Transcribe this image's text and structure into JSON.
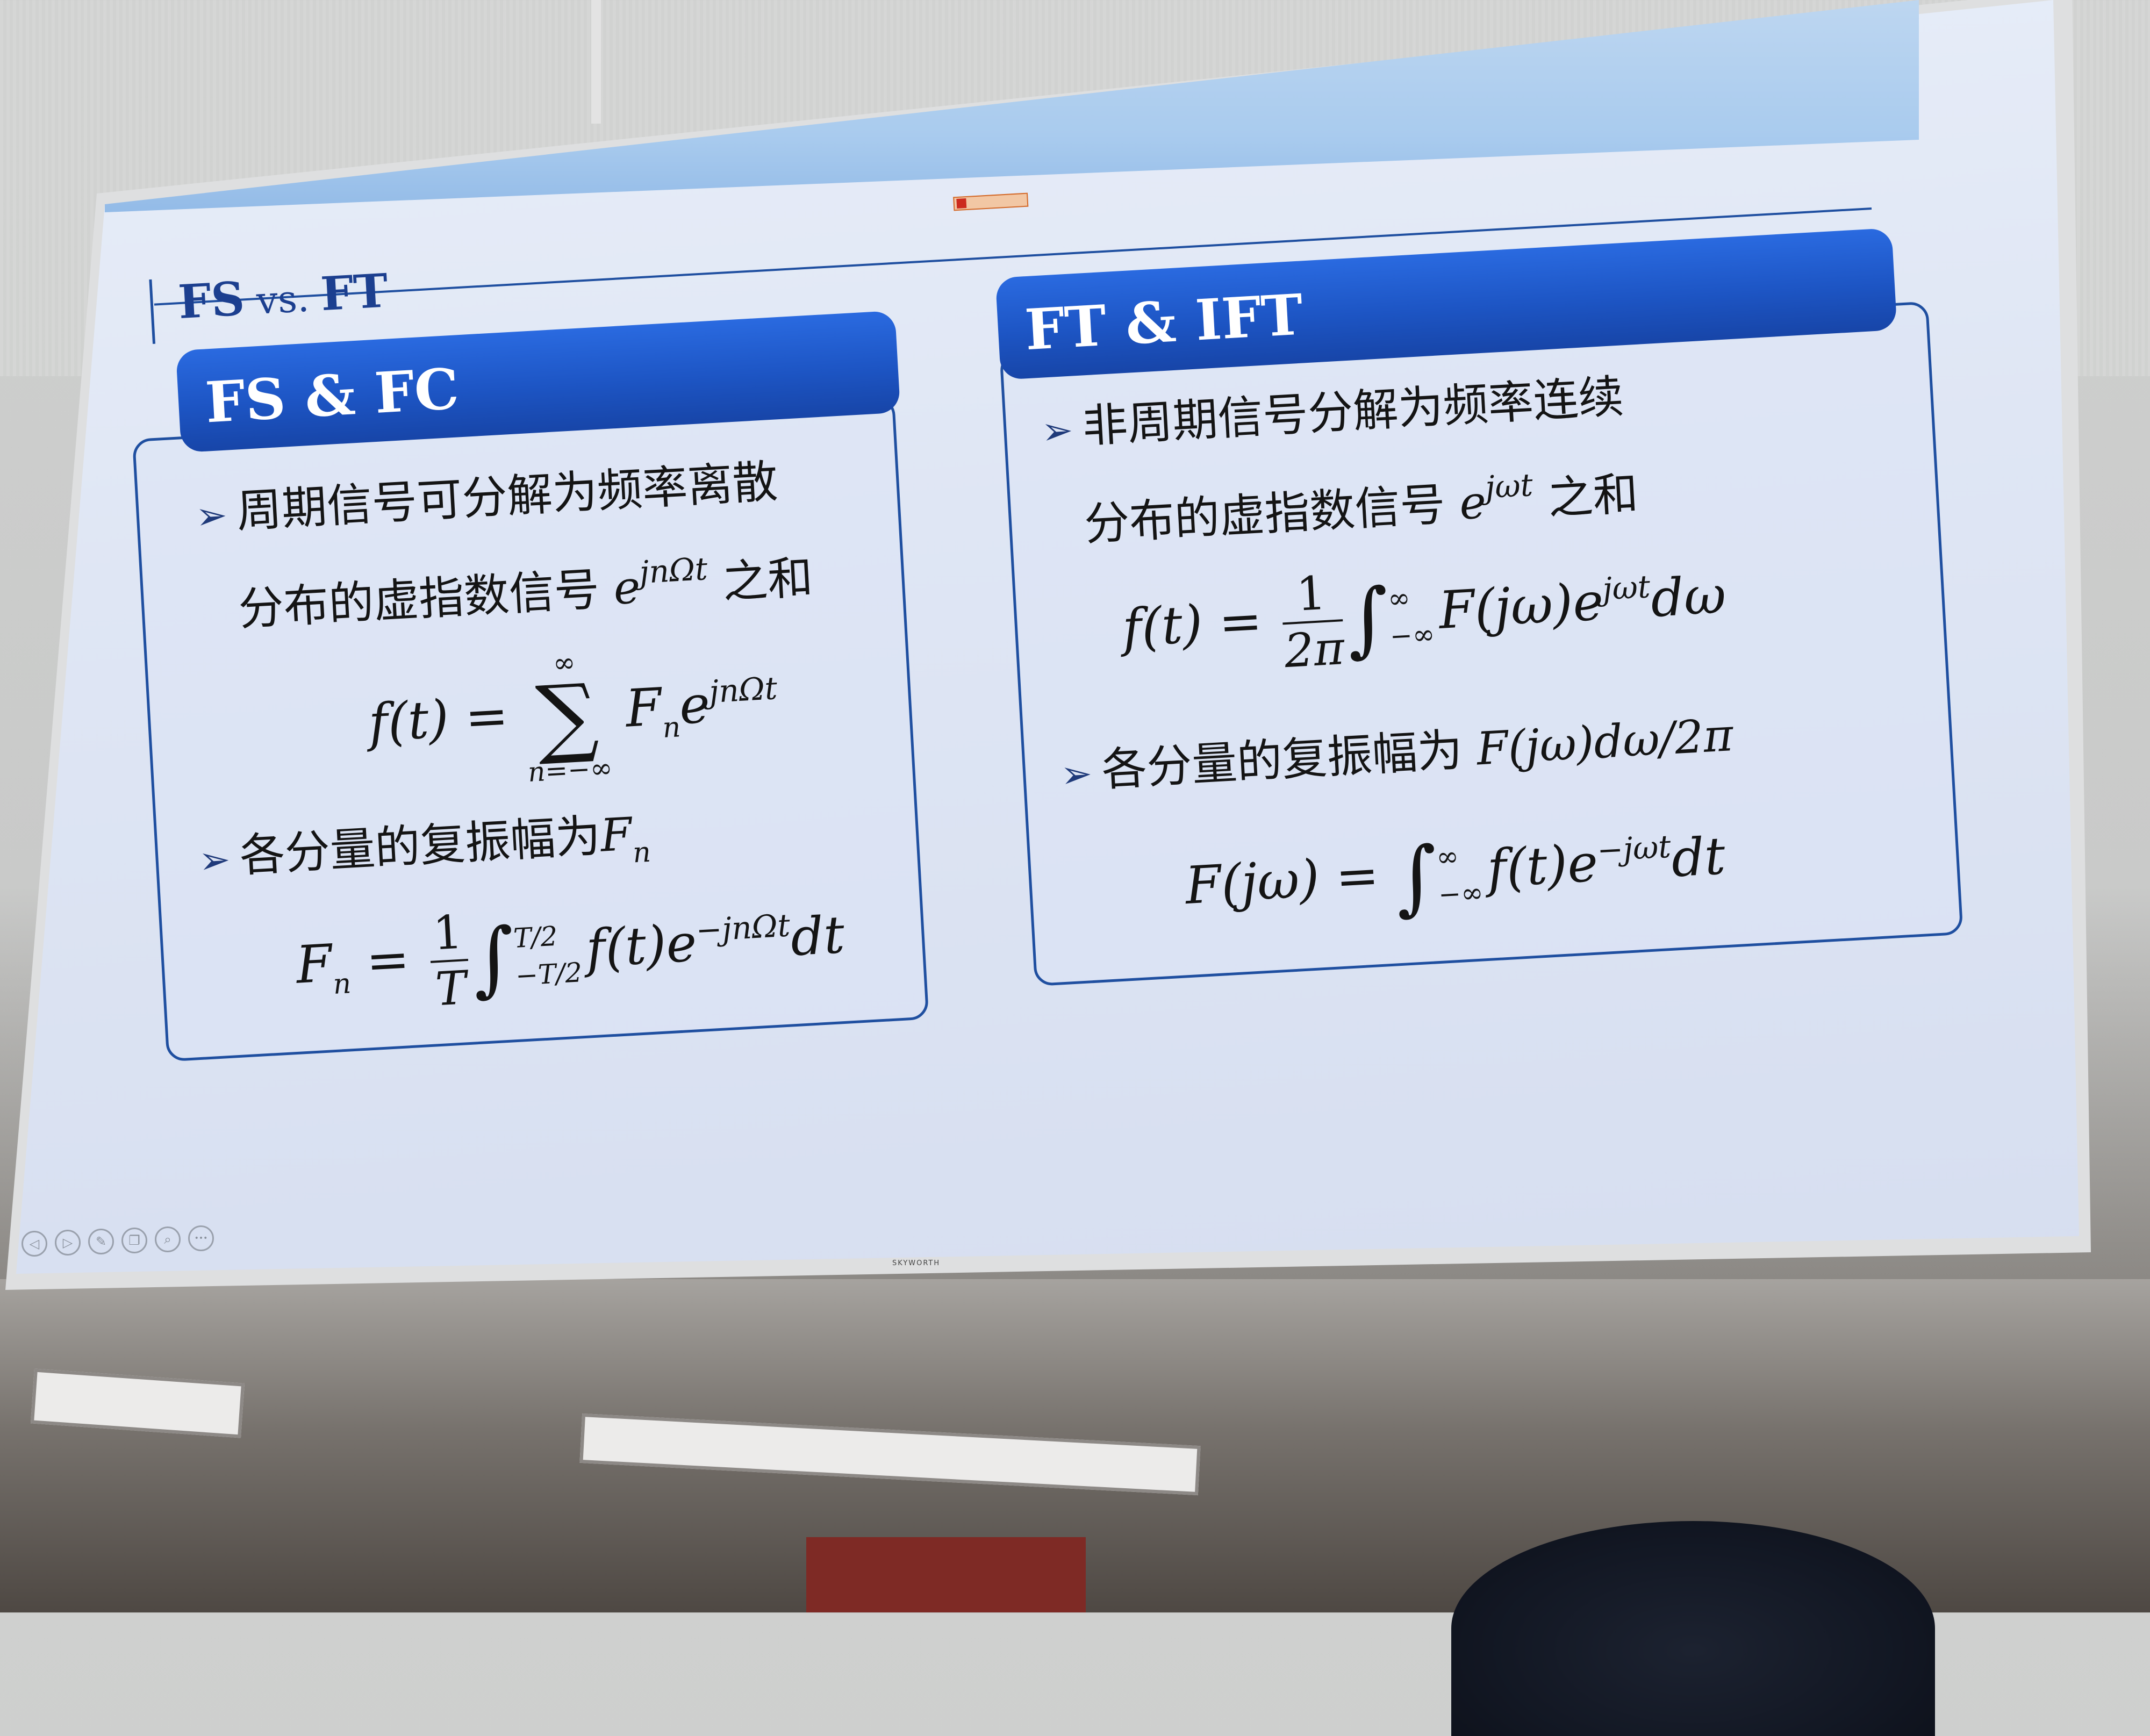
{
  "slide": {
    "logo_text": "",
    "title_main": "FS",
    "title_vs": " vs. ",
    "title_end": "FT",
    "left": {
      "heading": "FS & FC",
      "bullet1_line1": "周期信号可分解为频率离散",
      "bullet1_line2": "分布的虚指数信号",
      "bullet1_exp_base": "e",
      "bullet1_exp_sup": "jnΩt",
      "bullet1_tail": "之和",
      "formula1_lhs": "f(t) =",
      "formula1_sigma_top": "∞",
      "formula1_sigma": "∑",
      "formula1_sigma_bottom": "n=−∞",
      "formula1_term": "F",
      "formula1_term_sub": "n",
      "formula1_exp_base": "e",
      "formula1_exp_sup": "jnΩt",
      "bullet2_text": "各分量的复振幅为",
      "bullet2_var": "F",
      "bullet2_sub": "n",
      "formula2_lhs": "F",
      "formula2_lhs_sub": "n",
      "formula2_eq": "=",
      "formula2_num": "1",
      "formula2_den": "T",
      "formula2_upper": "T/2",
      "formula2_lower": "−T/2",
      "formula2_body": "f(t)e",
      "formula2_sup": "−jnΩt",
      "formula2_dt": "dt"
    },
    "right": {
      "heading": "FT & IFT",
      "bullet1_line1": "非周期信号分解为频率连续",
      "bullet1_line2": "分布的虚指数信号",
      "bullet1_exp_base": "e",
      "bullet1_exp_sup": "jωt",
      "bullet1_tail": "之和",
      "formula1_lhs": "f(t) =",
      "formula1_num": "1",
      "formula1_den": "2π",
      "formula1_upper": "∞",
      "formula1_lower": "−∞",
      "formula1_body": "F(jω)e",
      "formula1_sup": "jωt",
      "formula1_d": "dω",
      "bullet2_text": "各分量的复振幅为",
      "bullet2_math": "F(jω)dω/2π",
      "formula2_lhs": "F(jω) =",
      "formula2_upper": "∞",
      "formula2_lower": "−∞",
      "formula2_body": "f(t)e",
      "formula2_sup": "−jωt",
      "formula2_dt": "dt"
    }
  },
  "tv_brand": "SKYWORTH",
  "toolbar": {
    "prev": "◁",
    "next": "▷",
    "pen": "✎",
    "copy": "❐",
    "zoom": "⌕",
    "more": "•••"
  },
  "colors": {
    "accent": "#1f4fa0",
    "header_blue": "#1d55c4",
    "screen_bg": "#dfe6f4"
  }
}
